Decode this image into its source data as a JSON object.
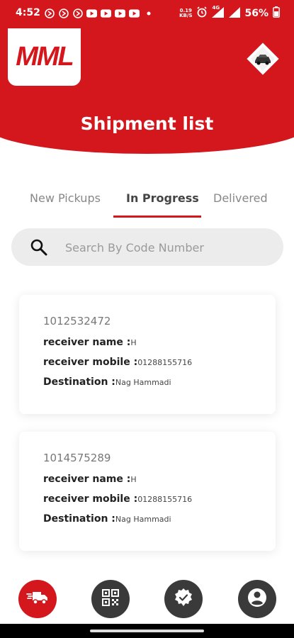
{
  "status_bar": {
    "time": "4:52",
    "net_speed_value": "0.19",
    "net_speed_unit": "KB/S",
    "network": "4G",
    "battery": "56%"
  },
  "header": {
    "logo_text": "MML",
    "title": "Shipment list"
  },
  "tabs": [
    {
      "label": "New Pickups",
      "active": false
    },
    {
      "label": "In Progress",
      "active": true
    },
    {
      "label": "Delivered",
      "active": false
    }
  ],
  "search": {
    "placeholder": "Search By Code Number",
    "value": ""
  },
  "shipments": [
    {
      "code": "1012532472",
      "receiver_name_label": "receiver name :",
      "receiver_name": "H",
      "receiver_mobile_label": "receiver mobile :",
      "receiver_mobile": "01288155716",
      "destination_label": "Destination :",
      "destination": "Nag Hammadi"
    },
    {
      "code": "1014575289",
      "receiver_name_label": "receiver name :",
      "receiver_name": "H",
      "receiver_mobile_label": "receiver mobile :",
      "receiver_mobile": "01288155716",
      "destination_label": "Destination :",
      "destination": "Nag Hammadi"
    }
  ],
  "bottom_nav": [
    {
      "icon": "delivery-truck-icon",
      "active": true
    },
    {
      "icon": "qr-code-icon",
      "active": false
    },
    {
      "icon": "verified-badge-icon",
      "active": false
    },
    {
      "icon": "account-icon",
      "active": false
    }
  ],
  "colors": {
    "primary": "#d3171d",
    "nav_dark": "#3a3a3a"
  }
}
